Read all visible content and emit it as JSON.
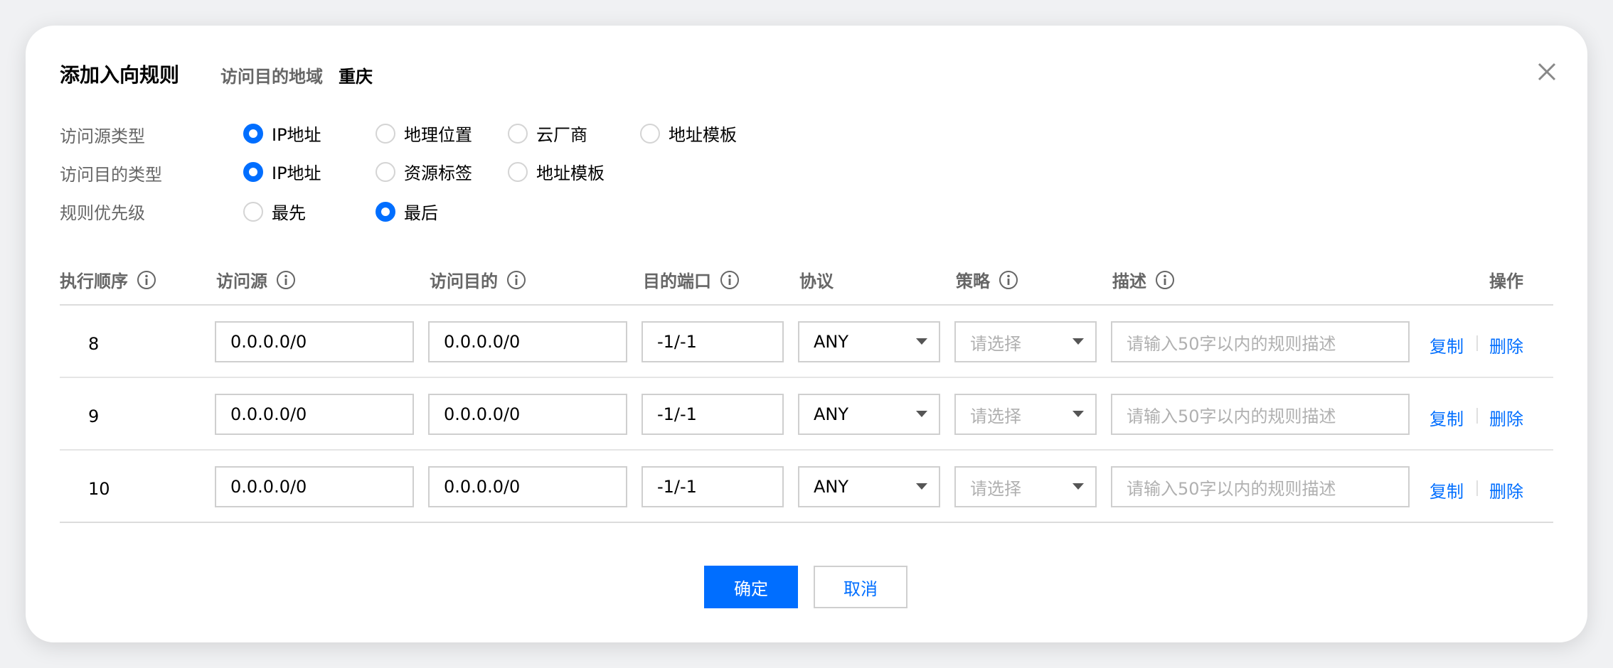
{
  "dialog": {
    "title": "添加入向规则",
    "region_label": "访问目的地域",
    "region_value": "重庆"
  },
  "form": {
    "source_type": {
      "label": "访问源类型",
      "options": [
        "IP地址",
        "地理位置",
        "云厂商",
        "地址模板"
      ],
      "selected": "IP地址"
    },
    "dest_type": {
      "label": "访问目的类型",
      "options": [
        "IP地址",
        "资源标签",
        "地址模板"
      ],
      "selected": "IP地址"
    },
    "priority": {
      "label": "规则优先级",
      "options": [
        "最先",
        "最后"
      ],
      "selected": "最后"
    }
  },
  "table": {
    "headers": {
      "order": "执行顺序",
      "source": "访问源",
      "dest": "访问目的",
      "port": "目的端口",
      "protocol": "协议",
      "policy": "策略",
      "desc": "描述",
      "ops": "操作"
    },
    "rows": [
      {
        "order": "8",
        "source": "0.0.0.0/0",
        "dest": "0.0.0.0/0",
        "port": "-1/-1",
        "protocol": "ANY",
        "policy_placeholder": "请选择",
        "desc_placeholder": "请输入50字以内的规则描述",
        "copy": "复制",
        "delete": "删除"
      },
      {
        "order": "9",
        "source": "0.0.0.0/0",
        "dest": "0.0.0.0/0",
        "port": "-1/-1",
        "protocol": "ANY",
        "policy_placeholder": "请选择",
        "desc_placeholder": "请输入50字以内的规则描述",
        "copy": "复制",
        "delete": "删除"
      },
      {
        "order": "10",
        "source": "0.0.0.0/0",
        "dest": "0.0.0.0/0",
        "port": "-1/-1",
        "protocol": "ANY",
        "policy_placeholder": "请选择",
        "desc_placeholder": "请输入50字以内的规则描述",
        "copy": "复制",
        "delete": "删除"
      }
    ]
  },
  "buttons": {
    "confirm": "确定",
    "cancel": "取消"
  },
  "colors": {
    "accent": "#006eff",
    "label_gray": "#666666",
    "placeholder": "#b0b0b0"
  }
}
